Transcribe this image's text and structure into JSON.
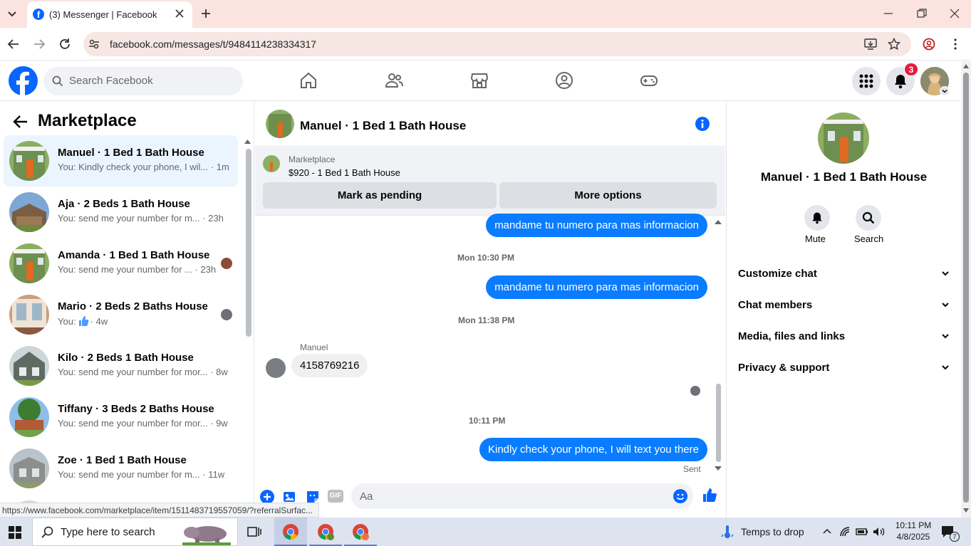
{
  "browser": {
    "tab_title": "(3) Messenger | Facebook",
    "url": "facebook.com/messages/t/9484114238334317",
    "status_url": "https://www.facebook.com/marketplace/item/1511483719557059/?referralSurfac..."
  },
  "fb_header": {
    "search_placeholder": "Search Facebook",
    "notification_count": "3"
  },
  "left": {
    "title": "Marketplace",
    "conversations": [
      {
        "title": "Manuel · 1 Bed 1 Bath House",
        "preview": "You: Kindly check your phone, I wil... · 1m"
      },
      {
        "title": "Aja · 2 Beds 1 Bath House",
        "preview": "You: send me your number for m... · 23h"
      },
      {
        "title": "Amanda · 1 Bed 1 Bath House",
        "preview": "You: send me your number for ... · 23h"
      },
      {
        "title": "Mario · 2 Beds 2 Baths House",
        "preview_prefix": "You:",
        "preview_suffix": "· 4w"
      },
      {
        "title": "Kilo · 2 Beds 1 Bath House",
        "preview": "You: send me your number for mor... · 8w"
      },
      {
        "title": "Tiffany · 3 Beds 2 Baths House",
        "preview": "You: send me your number for mor... · 9w"
      },
      {
        "title": "Zoe · 1 Bed 1 Bath House",
        "preview": "You: send me your number for m... · 11w"
      }
    ]
  },
  "chat": {
    "header_title": "Manuel · 1 Bed 1 Bath House",
    "listing_label": "Marketplace",
    "listing_price": "$920 - 1 Bed 1 Bath House",
    "mark_pending": "Mark as pending",
    "more_options": "More options",
    "messages": [
      {
        "text": "mandame tu numero para mas informacion"
      },
      {
        "time": "Mon 10:30 PM"
      },
      {
        "text": "mandame tu numero para mas informacion"
      },
      {
        "time": "Mon 11:38 PM"
      },
      {
        "sender": "Manuel",
        "text": "4158769216"
      },
      {
        "time": "10:11 PM"
      },
      {
        "text": "Kindly check your phone, I will text you there"
      }
    ],
    "sent_status": "Sent",
    "composer_placeholder": "Aa"
  },
  "right": {
    "name": "Manuel · 1 Bed 1 Bath House",
    "mute": "Mute",
    "search": "Search",
    "sections": [
      "Customize chat",
      "Chat members",
      "Media, files and links",
      "Privacy & support"
    ]
  },
  "taskbar": {
    "search_placeholder": "Type here to search",
    "weather": "Temps to drop",
    "time": "10:11 PM",
    "date": "4/8/2025",
    "notif_count": "7"
  },
  "colors": {
    "fb_blue": "#0866ff",
    "bubble": "#0a7cff",
    "badge": "#e41e3f"
  }
}
